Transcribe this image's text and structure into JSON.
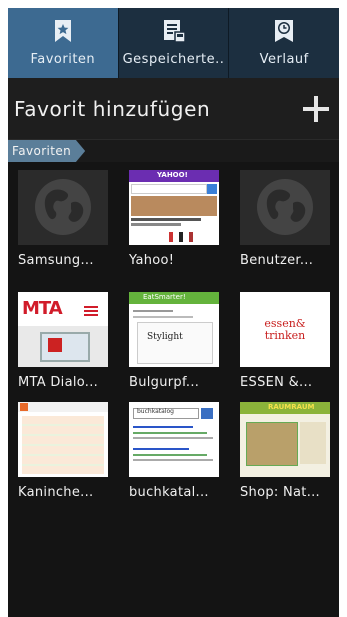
{
  "tabs": [
    {
      "label": "Favoriten",
      "icon": "bookmark-star-icon",
      "active": true
    },
    {
      "label": "Gespeicherte..",
      "icon": "saved-pages-icon",
      "active": false
    },
    {
      "label": "Verlauf",
      "icon": "history-clock-icon",
      "active": false
    }
  ],
  "add_bookmark": {
    "label": "Favorit hinzufügen",
    "icon": "plus-icon"
  },
  "breadcrumb": {
    "label": "Favoriten"
  },
  "bookmarks": [
    {
      "label": "Samsung...",
      "thumb": "empty"
    },
    {
      "label": "Yahoo!",
      "thumb": "yahoo"
    },
    {
      "label": "Benutzer...",
      "thumb": "empty"
    },
    {
      "label": "MTA Dialo...",
      "thumb": "mta"
    },
    {
      "label": "Bulgurpf...",
      "thumb": "eatsmarter"
    },
    {
      "label": "ESSEN &...",
      "thumb": "essen"
    },
    {
      "label": "Kaninche...",
      "thumb": "kaninchen"
    },
    {
      "label": "buchkatal...",
      "thumb": "buchkatalog"
    },
    {
      "label": "Shop: Nat...",
      "thumb": "shop"
    }
  ],
  "thumb_text": {
    "yahoo_logo": "YAHOO!",
    "mta_logo": "MTA",
    "eatsmarter_logo": "EatSmarter!",
    "stylight": "Stylight",
    "essen_logo_1": "essen&",
    "essen_logo_2": "trinken",
    "buch_search": "buchkatalog",
    "shop_logo": "RAUMRAUM"
  },
  "colors": {
    "accent": "#3d6a91",
    "tabbar": "#1c2f40",
    "background": "#141414",
    "crumb": "#5b7e99"
  }
}
